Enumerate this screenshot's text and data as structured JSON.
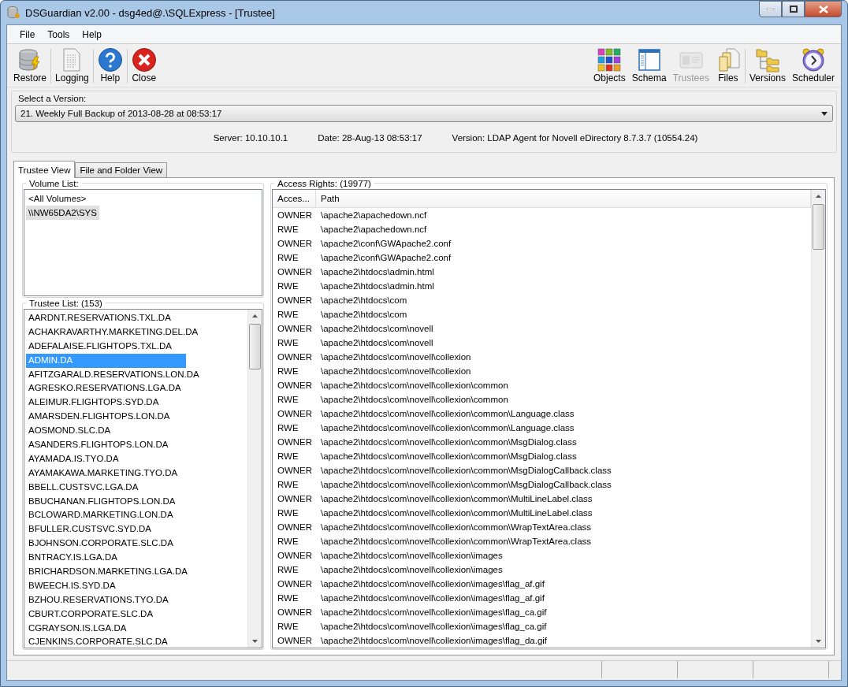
{
  "window": {
    "title": "DSGuardian v2.00 - dsg4ed@.\\SQLExpress - [Trustee]"
  },
  "menu": [
    "File",
    "Tools",
    "Help"
  ],
  "toolbar_left": [
    {
      "label": "Restore",
      "kind": "database",
      "disabled": false
    },
    {
      "label": "Logging",
      "kind": "document",
      "disabled": false
    },
    {
      "label": "Help",
      "kind": "help",
      "disabled": false
    },
    {
      "label": "Close",
      "kind": "close",
      "disabled": false
    }
  ],
  "toolbar_right": [
    {
      "label": "Objects",
      "kind": "grid",
      "disabled": false
    },
    {
      "label": "Schema",
      "kind": "schema",
      "disabled": false
    },
    {
      "label": "Trustees",
      "kind": "card",
      "disabled": true
    },
    {
      "label": "Files",
      "kind": "files",
      "disabled": false
    },
    {
      "label": "Versions",
      "kind": "folders",
      "disabled": false
    },
    {
      "label": "Scheduler",
      "kind": "clock",
      "disabled": false
    }
  ],
  "version": {
    "label": "Select a Version:",
    "value": "21. Weekly Full Backup of 2013-08-28 at 08:53:17"
  },
  "info": [
    "Server: 10.10.10.1",
    "Date: 28-Aug-13 08:53:17",
    "Version: LDAP Agent for Novell eDirectory 8.7.3.7 (10554.24)"
  ],
  "tabs": [
    {
      "label": "Trustee View",
      "selected": true
    },
    {
      "label": "File and Folder View",
      "selected": false
    }
  ],
  "volume_list": {
    "title": "Volume List:",
    "items": [
      {
        "label": "<All Volumes>",
        "selected": false
      },
      {
        "label": "\\\\NW65DA2\\SYS",
        "selected": true
      }
    ]
  },
  "trustee_list": {
    "title": "Trustee List: (153)",
    "items": [
      {
        "label": "AARDNT.RESERVATIONS.TXL.DA",
        "selected": false
      },
      {
        "label": "ACHAKRAVARTHY.MARKETING.DEL.DA",
        "selected": false
      },
      {
        "label": "ADEFALAISE.FLIGHTOPS.TXL.DA",
        "selected": false
      },
      {
        "label": "ADMIN.DA",
        "selected": true
      },
      {
        "label": "AFITZGARALD.RESERVATIONS.LON.DA",
        "selected": false
      },
      {
        "label": "AGRESKO.RESERVATIONS.LGA.DA",
        "selected": false
      },
      {
        "label": "ALEIMUR.FLIGHTOPS.SYD.DA",
        "selected": false
      },
      {
        "label": "AMARSDEN.FLIGHTOPS.LON.DA",
        "selected": false
      },
      {
        "label": "AOSMOND.SLC.DA",
        "selected": false
      },
      {
        "label": "ASANDERS.FLIGHTOPS.LON.DA",
        "selected": false
      },
      {
        "label": "AYAMADA.IS.TYO.DA",
        "selected": false
      },
      {
        "label": "AYAMAKAWA.MARKETING.TYO.DA",
        "selected": false
      },
      {
        "label": "BBELL.CUSTSVC.LGA.DA",
        "selected": false
      },
      {
        "label": "BBUCHANAN.FLIGHTOPS.LON.DA",
        "selected": false
      },
      {
        "label": "BCLOWARD.MARKETING.LON.DA",
        "selected": false
      },
      {
        "label": "BFULLER.CUSTSVC.SYD.DA",
        "selected": false
      },
      {
        "label": "BJOHNSON.CORPORATE.SLC.DA",
        "selected": false
      },
      {
        "label": "BNTRACY.IS.LGA.DA",
        "selected": false
      },
      {
        "label": "BRICHARDSON.MARKETING.LGA.DA",
        "selected": false
      },
      {
        "label": "BWEECH.IS.SYD.DA",
        "selected": false
      },
      {
        "label": "BZHOU.RESERVATIONS.TYO.DA",
        "selected": false
      },
      {
        "label": "CBURT.CORPORATE.SLC.DA",
        "selected": false
      },
      {
        "label": "CGRAYSON.IS.LGA.DA",
        "selected": false
      },
      {
        "label": "CJENKINS.CORPORATE.SLC.DA",
        "selected": false
      }
    ]
  },
  "access_rights": {
    "title": "Access Rights: (19977)",
    "columns": [
      "Acces...",
      "Path"
    ],
    "rows": [
      {
        "access": "OWNER",
        "path": "\\apache2\\apachedown.ncf"
      },
      {
        "access": "RWE",
        "path": "\\apache2\\apachedown.ncf"
      },
      {
        "access": "OWNER",
        "path": "\\apache2\\conf\\GWApache2.conf"
      },
      {
        "access": "RWE",
        "path": "\\apache2\\conf\\GWApache2.conf"
      },
      {
        "access": "OWNER",
        "path": "\\apache2\\htdocs\\admin.html"
      },
      {
        "access": "RWE",
        "path": "\\apache2\\htdocs\\admin.html"
      },
      {
        "access": "OWNER",
        "path": "\\apache2\\htdocs\\com"
      },
      {
        "access": "RWE",
        "path": "\\apache2\\htdocs\\com"
      },
      {
        "access": "OWNER",
        "path": "\\apache2\\htdocs\\com\\novell"
      },
      {
        "access": "RWE",
        "path": "\\apache2\\htdocs\\com\\novell"
      },
      {
        "access": "OWNER",
        "path": "\\apache2\\htdocs\\com\\novell\\collexion"
      },
      {
        "access": "RWE",
        "path": "\\apache2\\htdocs\\com\\novell\\collexion"
      },
      {
        "access": "OWNER",
        "path": "\\apache2\\htdocs\\com\\novell\\collexion\\common"
      },
      {
        "access": "RWE",
        "path": "\\apache2\\htdocs\\com\\novell\\collexion\\common"
      },
      {
        "access": "OWNER",
        "path": "\\apache2\\htdocs\\com\\novell\\collexion\\common\\Language.class"
      },
      {
        "access": "RWE",
        "path": "\\apache2\\htdocs\\com\\novell\\collexion\\common\\Language.class"
      },
      {
        "access": "OWNER",
        "path": "\\apache2\\htdocs\\com\\novell\\collexion\\common\\MsgDialog.class"
      },
      {
        "access": "RWE",
        "path": "\\apache2\\htdocs\\com\\novell\\collexion\\common\\MsgDialog.class"
      },
      {
        "access": "OWNER",
        "path": "\\apache2\\htdocs\\com\\novell\\collexion\\common\\MsgDialogCallback.class"
      },
      {
        "access": "RWE",
        "path": "\\apache2\\htdocs\\com\\novell\\collexion\\common\\MsgDialogCallback.class"
      },
      {
        "access": "OWNER",
        "path": "\\apache2\\htdocs\\com\\novell\\collexion\\common\\MultiLineLabel.class"
      },
      {
        "access": "RWE",
        "path": "\\apache2\\htdocs\\com\\novell\\collexion\\common\\MultiLineLabel.class"
      },
      {
        "access": "OWNER",
        "path": "\\apache2\\htdocs\\com\\novell\\collexion\\common\\WrapTextArea.class"
      },
      {
        "access": "RWE",
        "path": "\\apache2\\htdocs\\com\\novell\\collexion\\common\\WrapTextArea.class"
      },
      {
        "access": "OWNER",
        "path": "\\apache2\\htdocs\\com\\novell\\collexion\\images"
      },
      {
        "access": "RWE",
        "path": "\\apache2\\htdocs\\com\\novell\\collexion\\images"
      },
      {
        "access": "OWNER",
        "path": "\\apache2\\htdocs\\com\\novell\\collexion\\images\\flag_af.gif"
      },
      {
        "access": "RWE",
        "path": "\\apache2\\htdocs\\com\\novell\\collexion\\images\\flag_af.gif"
      },
      {
        "access": "OWNER",
        "path": "\\apache2\\htdocs\\com\\novell\\collexion\\images\\flag_ca.gif"
      },
      {
        "access": "RWE",
        "path": "\\apache2\\htdocs\\com\\novell\\collexion\\images\\flag_ca.gif"
      },
      {
        "access": "OWNER",
        "path": "\\apache2\\htdocs\\com\\novell\\collexion\\images\\flag_da.gif"
      }
    ]
  }
}
